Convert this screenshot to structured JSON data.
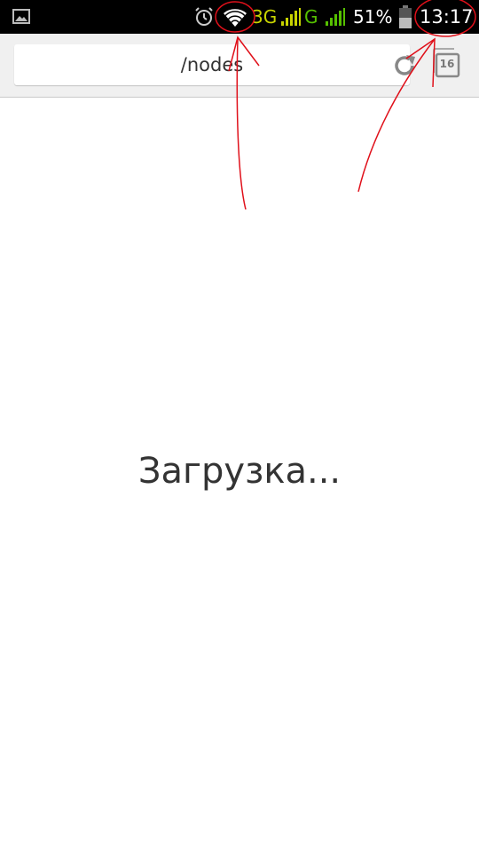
{
  "status_bar": {
    "network_3g_label": "3G",
    "network_g_label": "G",
    "battery_percent": "51%",
    "time": "13:17",
    "icons": [
      "gallery-icon",
      "alarm-icon",
      "wifi-icon",
      "signal-icon",
      "signal-icon",
      "battery-icon"
    ],
    "colors": {
      "network_3g": "#c8d400",
      "network_g": "#56c000"
    }
  },
  "toolbar": {
    "url": "/nodes",
    "tab_count": "16",
    "icons": [
      "reload-icon",
      "tabs-icon"
    ]
  },
  "content": {
    "loading_text": "Загрузка..."
  },
  "annotation_color": "#e0101a"
}
